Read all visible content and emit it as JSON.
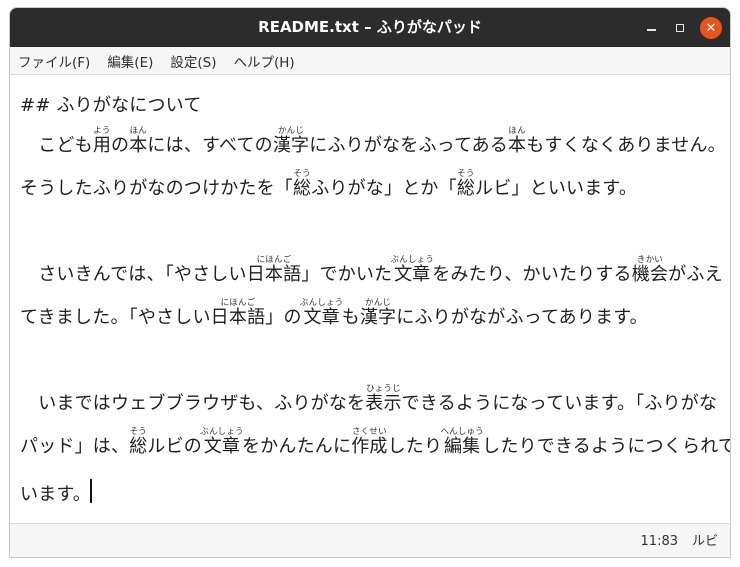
{
  "window": {
    "title": "README.txt – ふりがなパッド",
    "close_glyph": "✕"
  },
  "menu": {
    "file": "ファイル(F)",
    "edit": "編集(E)",
    "settings": "設定(S)",
    "help": "ヘルプ(H)"
  },
  "document": {
    "heading": "## ふりがなについて",
    "p1": {
      "a": "　こども",
      "r_you_base": "用",
      "r_you_rt": "よう",
      "b": "の",
      "r_hon_base": "本",
      "r_hon_rt": "ほん",
      "c": "には、すべての",
      "r_kanji_base": "漢字",
      "r_kanji_rt": "かんじ",
      "d": "にふりがなをふってある",
      "r_hon2_base": "本",
      "r_hon2_rt": "ほん",
      "e": "もすくなくありません。",
      "f": "そうしたふりがなのつけかたを「",
      "r_sou_base": "総",
      "r_sou_rt": "そう",
      "g": "ふりがな」とか「",
      "r_sou2_base": "総",
      "r_sou2_rt": "そう",
      "h": "ルビ」といいます。"
    },
    "p2": {
      "a": "　さいきんでは、「やさしい",
      "r_nihongo_base": "日本語",
      "r_nihongo_rt": "にほんご",
      "b": "」でかいた",
      "r_bunshou_base": "文章",
      "r_bunshou_rt": "ぶんしょう",
      "c": "をみたり、かいたりする",
      "r_kikai_base": "機会",
      "r_kikai_rt": "きかい",
      "d": "がふえ",
      "e": "てきました。「やさしい",
      "r_nihongo2_base": "日本語",
      "r_nihongo2_rt": "にほんご",
      "f": "」の",
      "r_bunshou2_base": "文章",
      "r_bunshou2_rt": "ぶんしょう",
      "g": "も",
      "r_kanji2_base": "漢字",
      "r_kanji2_rt": "かんじ",
      "h": "にふりがながふってあります。"
    },
    "p3": {
      "a": "　いまではウェブブラウザも、ふりがなを",
      "r_hyouji_base": "表示",
      "r_hyouji_rt": "ひょうじ",
      "b": "できるようになっています。「ふりがな",
      "c": "パッド」は、",
      "r_sou_base": "総",
      "r_sou_rt": "そう",
      "d": "ルビの",
      "r_bunshou_base": "文章",
      "r_bunshou_rt": "ぶんしょう",
      "e": "をかんたんに",
      "r_sakusei_base": "作成",
      "r_sakusei_rt": "さくせい",
      "f": "したり",
      "r_henshuu_base": "編集",
      "r_henshuu_rt": "へんしゅう",
      "g": "したりできるようにつくられて",
      "h": "います。"
    }
  },
  "status": {
    "position": "11:83",
    "mode": "ルビ"
  },
  "colors": {
    "titlebar": "#2c2c2c",
    "close_button": "#e9541c",
    "menubar": "#f6f6f6",
    "text": "#1e1e1e"
  }
}
